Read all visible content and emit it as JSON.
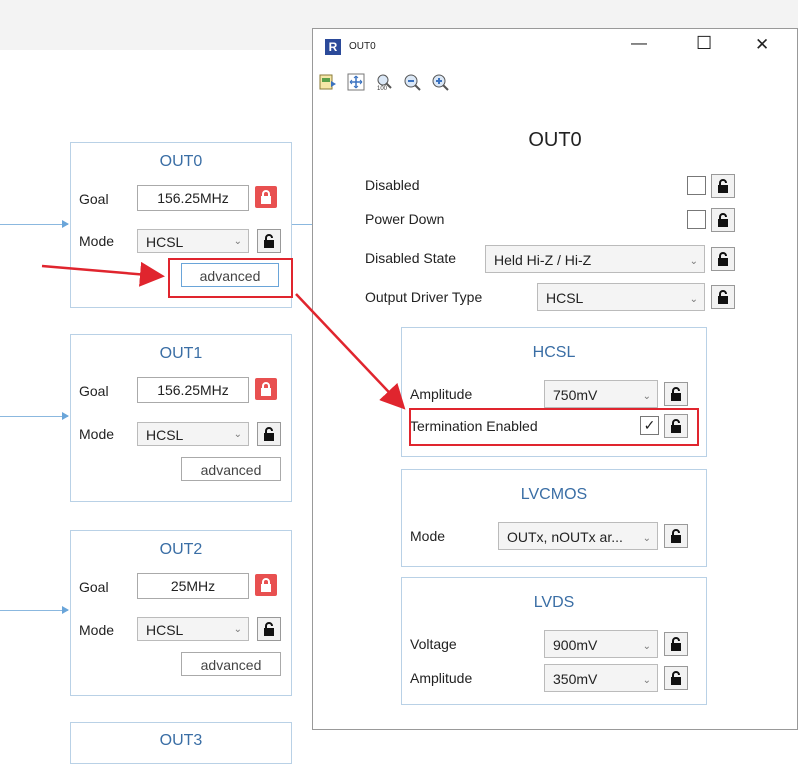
{
  "outputs": [
    {
      "title": "OUT0",
      "goal_label": "Goal",
      "goal_value": "156.25MHz",
      "mode_label": "Mode",
      "mode_value": "HCSL",
      "advanced_label": "advanced"
    },
    {
      "title": "OUT1",
      "goal_label": "Goal",
      "goal_value": "156.25MHz",
      "mode_label": "Mode",
      "mode_value": "HCSL",
      "advanced_label": "advanced"
    },
    {
      "title": "OUT2",
      "goal_label": "Goal",
      "goal_value": "25MHz",
      "mode_label": "Mode",
      "mode_value": "HCSL",
      "advanced_label": "advanced"
    },
    {
      "title": "OUT3"
    }
  ],
  "dialog": {
    "app_icon_letter": "R",
    "window_title": "OUT0",
    "controls": {
      "minimize": "—",
      "maximize": "☐",
      "close": "✕"
    },
    "toolbar_icons": [
      "export-icon",
      "fit-icon",
      "zoom-100-icon",
      "zoom-out-icon",
      "zoom-in-icon"
    ],
    "heading": "OUT0",
    "disabled_label": "Disabled",
    "power_down_label": "Power Down",
    "disabled_state_label": "Disabled State",
    "disabled_state_value": "Held Hi-Z / Hi-Z",
    "output_driver_label": "Output Driver Type",
    "output_driver_value": "HCSL",
    "hcsl": {
      "title": "HCSL",
      "amplitude_label": "Amplitude",
      "amplitude_value": "750mV",
      "termination_label": "Termination Enabled",
      "termination_check": "✓"
    },
    "lvcmos": {
      "title": "LVCMOS",
      "mode_label": "Mode",
      "mode_value": "OUTx, nOUTx ar..."
    },
    "lvds": {
      "title": "LVDS",
      "voltage_label": "Voltage",
      "voltage_value": "900mV",
      "amplitude_label": "Amplitude",
      "amplitude_value": "350mV"
    }
  },
  "colors": {
    "accent_title": "#3a6ea5",
    "highlight_red": "#e0252e",
    "lock_red": "#e85050"
  }
}
